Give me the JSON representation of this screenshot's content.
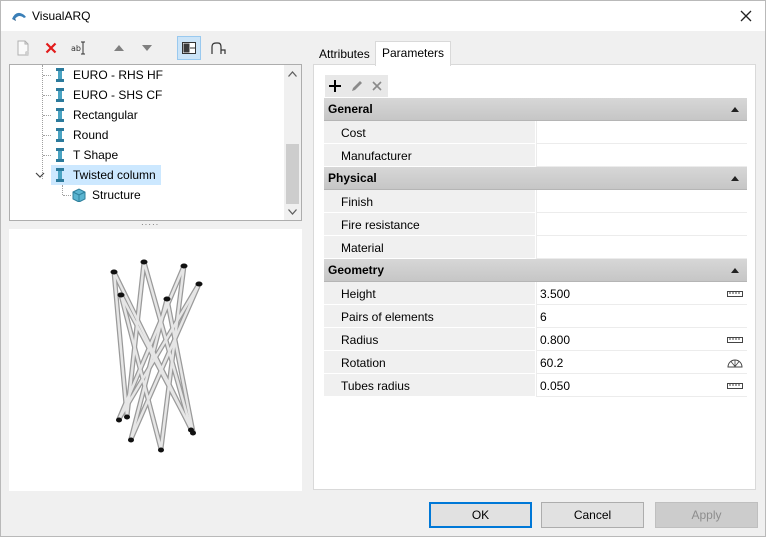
{
  "window": {
    "title": "VisualARQ"
  },
  "toolbar": {
    "items": [
      {
        "icon": "new-style-icon",
        "enabled": false
      },
      {
        "icon": "delete-icon",
        "enabled": true
      },
      {
        "icon": "rename-icon",
        "enabled": true
      },
      {
        "icon": "move-up-icon",
        "enabled": false
      },
      {
        "icon": "move-down-icon",
        "enabled": false
      },
      {
        "icon": "preview-toggle-icon",
        "enabled": true,
        "active": true
      },
      {
        "icon": "profile-icon",
        "enabled": true
      }
    ]
  },
  "tree": {
    "items": [
      {
        "label": "EURO - RHS HF",
        "level": 1,
        "icon": "column-style-icon"
      },
      {
        "label": "EURO - SHS CF",
        "level": 1,
        "icon": "column-style-icon"
      },
      {
        "label": "Rectangular",
        "level": 1,
        "icon": "column-style-icon"
      },
      {
        "label": "Round",
        "level": 1,
        "icon": "column-style-icon"
      },
      {
        "label": "T Shape",
        "level": 1,
        "icon": "column-style-icon"
      },
      {
        "label": "Twisted column",
        "level": 1,
        "icon": "column-style-icon",
        "selected": true,
        "expanded": true
      },
      {
        "label": "Structure",
        "level": 2,
        "icon": "component-box-icon"
      }
    ]
  },
  "tabs": [
    {
      "label": "Attributes",
      "active": false
    },
    {
      "label": "Parameters",
      "active": true
    }
  ],
  "params_toolbar": {
    "add": "add-icon",
    "edit": "edit-icon",
    "remove": "remove-icon"
  },
  "categories": [
    {
      "name": "General",
      "expanded": true,
      "props": [
        {
          "name": "Cost",
          "value": ""
        },
        {
          "name": "Manufacturer",
          "value": ""
        }
      ]
    },
    {
      "name": "Physical",
      "expanded": true,
      "props": [
        {
          "name": "Finish",
          "value": ""
        },
        {
          "name": "Fire resistance",
          "value": ""
        },
        {
          "name": "Material",
          "value": ""
        }
      ]
    },
    {
      "name": "Geometry",
      "expanded": true,
      "props": [
        {
          "name": "Height",
          "value": "3.500",
          "unit_icon": "length-ruler-icon"
        },
        {
          "name": "Pairs of elements",
          "value": "6"
        },
        {
          "name": "Radius",
          "value": "0.800",
          "unit_icon": "length-ruler-icon"
        },
        {
          "name": "Rotation",
          "value": "60.2",
          "unit_icon": "angle-protractor-icon"
        },
        {
          "name": "Tubes radius",
          "value": "0.050",
          "unit_icon": "length-ruler-icon"
        }
      ]
    }
  ],
  "buttons": {
    "ok": "OK",
    "cancel": "Cancel",
    "apply": "Apply"
  },
  "colors": {
    "selection": "#cce8ff",
    "category_bg": "#cfcfcf",
    "default_button_border": "#0078d7"
  }
}
